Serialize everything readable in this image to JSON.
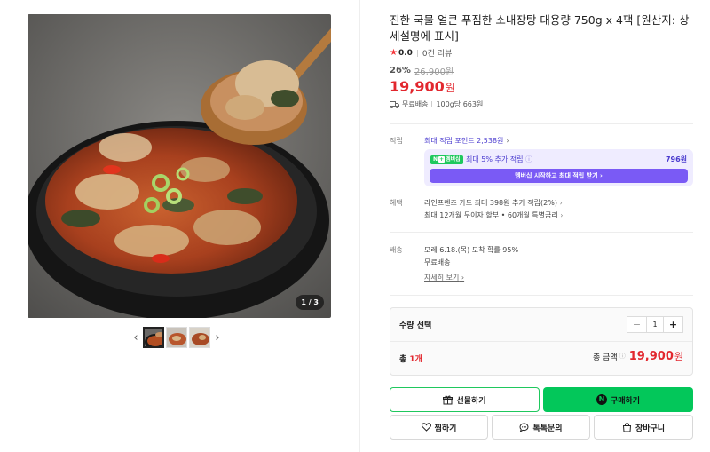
{
  "gallery": {
    "counter": "1 / 3",
    "prev_icon": "chevron-left-icon",
    "next_icon": "chevron-right-icon",
    "thumb_count": 3
  },
  "product": {
    "title": "진한 국물 얼큰 푸짐한 소내장탕 대용량 750g x 4팩 [원산지: 상세설명에 표시]",
    "rating_score": "0.0",
    "review_count": "0건 리뷰",
    "discount_rate": "26%",
    "original_price": "26,900원",
    "price": "19,900",
    "price_unit": "원",
    "shipping": "무료배송",
    "unit_price": "100g당 663원"
  },
  "points": {
    "label": "적립",
    "max_points": "최대 적립 포인트 2,538원",
    "npay_badge": "N",
    "npay_badge_text": "멤버십",
    "extra_text": "최대 5% 추가 적립",
    "extra_amount": "796원",
    "membership_button": "멤버십 시작하고 최대 적립 받기"
  },
  "benefits": {
    "label": "혜택",
    "line1": "라인프렌즈 카드 최대 398원 추가 적립(2%)",
    "line2": "최대 12개월 무이자 할부 • 60개월 특별금리"
  },
  "delivery": {
    "label": "배송",
    "arrival": "모레 6.18.(목) 도착 확률 95%",
    "fee": "무료배송",
    "detail_link": "자세히 보기"
  },
  "quantity": {
    "title": "수량 선택",
    "value": "1",
    "minus": "−",
    "plus": "+",
    "total_label": "총",
    "total_count": "1개",
    "amount_label": "총 금액",
    "amount_info": "ⓘ",
    "amount_value": "19,900",
    "amount_unit": "원"
  },
  "buttons": {
    "gift": "선물하기",
    "buy": "구매하기",
    "buy_logo": "N",
    "wish": "찜하기",
    "talk": "톡톡문의",
    "cart": "장바구니"
  },
  "colors": {
    "price_red": "#e2272e",
    "naver_green": "#03c75a",
    "membership_purple": "#7a5af5",
    "point_text": "#4b3ccf"
  }
}
